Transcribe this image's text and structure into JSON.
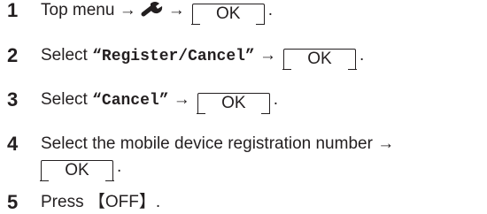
{
  "steps": [
    {
      "number": "1",
      "parts": [
        "Top menu",
        "→",
        "wrench-icon",
        "→",
        "OK",
        "."
      ]
    },
    {
      "number": "2",
      "text_before": "Select",
      "quoted": "“Register/Cancel”",
      "arrow": "→",
      "key": "OK",
      "end": "."
    },
    {
      "number": "3",
      "text_before": "Select",
      "quoted": "“Cancel”",
      "arrow": "→",
      "key": "OK",
      "end": "."
    },
    {
      "number": "4",
      "line1": "Select the mobile device registration number",
      "arrow": "→",
      "key": "OK",
      "end": "."
    },
    {
      "number": "5",
      "text_before": "Press",
      "button": "【OFF】",
      "end": "."
    }
  ],
  "colors": {
    "text": "#231f20"
  }
}
